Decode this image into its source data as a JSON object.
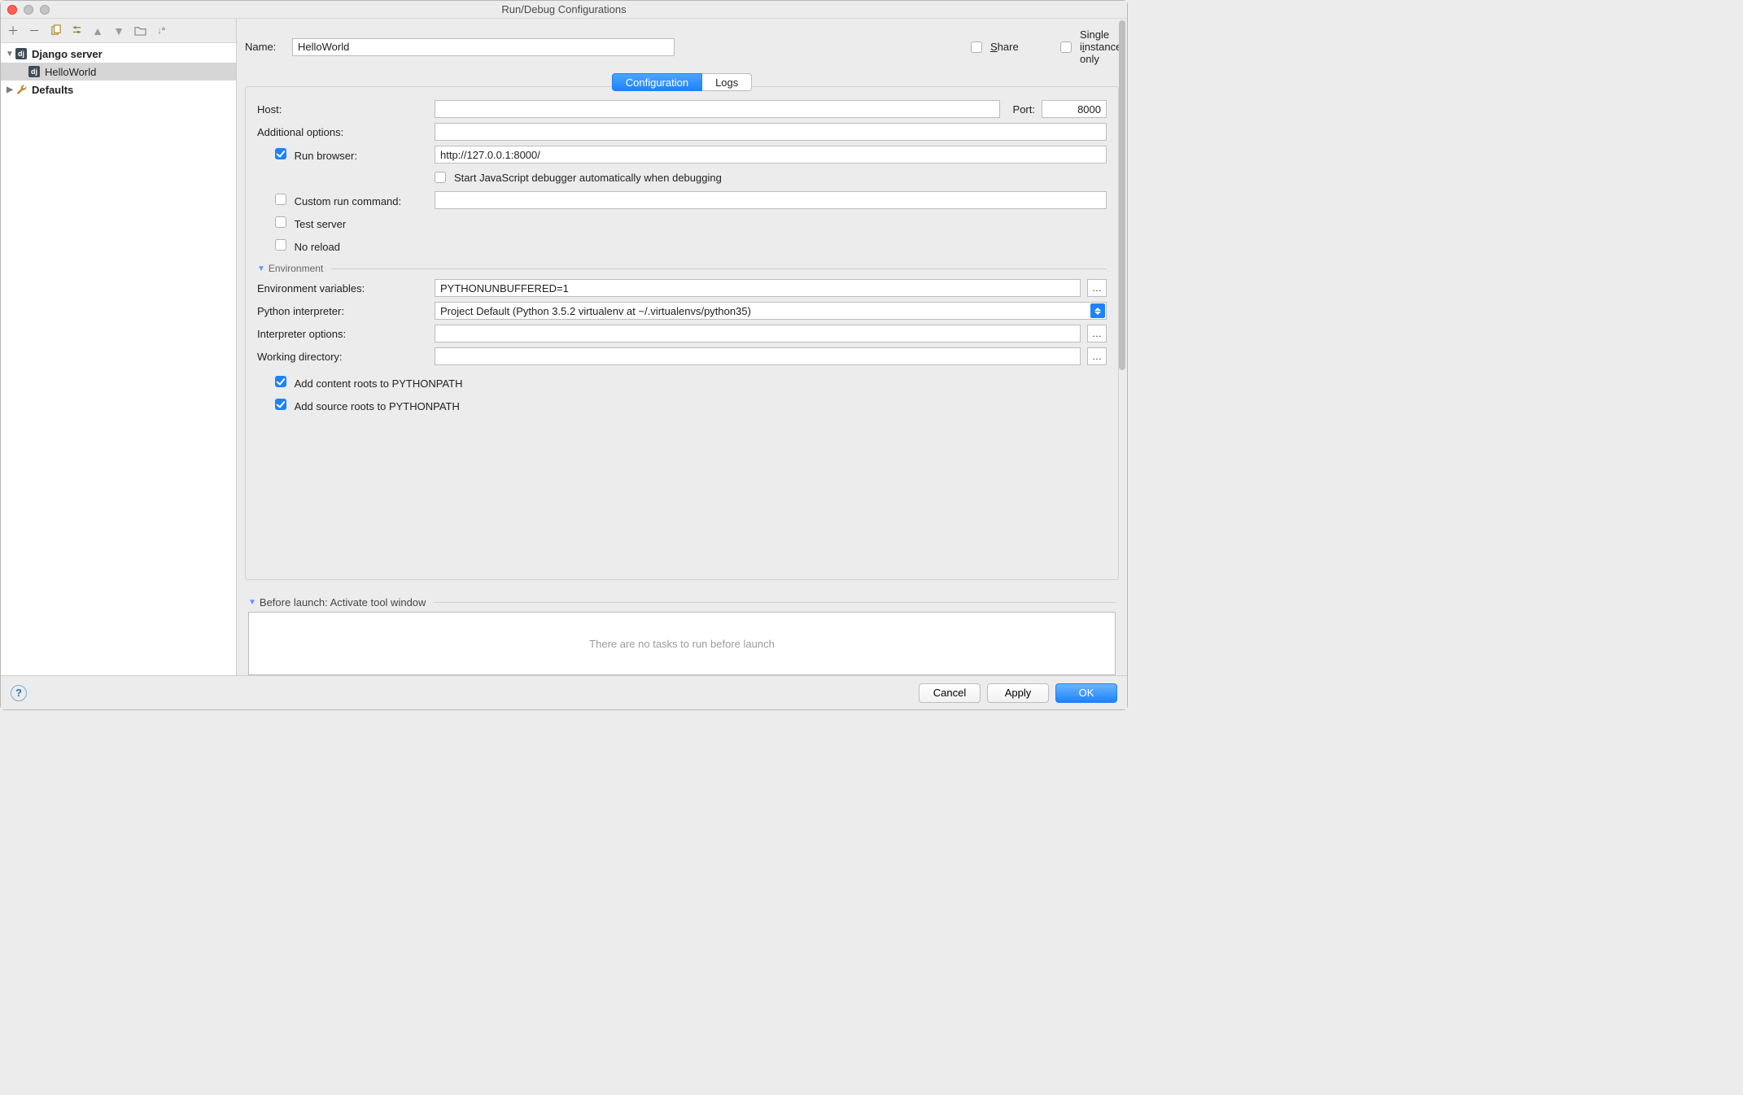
{
  "window": {
    "title": "Run/Debug Configurations"
  },
  "sidebar": {
    "items": [
      {
        "label": "Django server",
        "kind": "django-group"
      },
      {
        "label": "HelloWorld",
        "kind": "django-item"
      },
      {
        "label": "Defaults",
        "kind": "defaults-group"
      }
    ]
  },
  "nameRow": {
    "label": "Name:",
    "value": "HelloWorld",
    "share_label": "hare",
    "share_prefix": "S",
    "share_checked": false,
    "single_label": "nstance only",
    "single_prefix": "Single i",
    "single_checked": false
  },
  "tabs": {
    "configuration": "Configuration",
    "logs": "Logs"
  },
  "config": {
    "host_label": "Host:",
    "host_value": "",
    "port_label": "Port:",
    "port_value": "8000",
    "additional_label": "Additional options:",
    "additional_value": "",
    "run_browser_label": "Run browser:",
    "run_browser_checked": true,
    "run_browser_value": "http://127.0.0.1:8000/",
    "js_debugger_label": "Start JavaScript debugger automatically when debugging",
    "js_debugger_checked": false,
    "custom_run_label": "Custom run command:",
    "custom_run_checked": false,
    "custom_run_value": "",
    "test_server_label": "Test server",
    "test_server_checked": false,
    "no_reload_label": "No reload",
    "no_reload_checked": false,
    "env_section": "Environment",
    "env_vars_label": "Environment variables:",
    "env_vars_value": "PYTHONUNBUFFERED=1",
    "interpreter_label": "Python interpreter:",
    "interpreter_value": "Project Default (Python 3.5.2 virtualenv at ~/.virtualenvs/python35)",
    "interp_opts_label": "Interpreter options:",
    "interp_opts_value": "",
    "workdir_label": "Working directory:",
    "workdir_value": "",
    "add_content_label": "Add content roots to PYTHONPATH",
    "add_content_checked": true,
    "add_source_label": "Add source roots to PYTHONPATH",
    "add_source_checked": true
  },
  "beforeLaunch": {
    "header": "Before launch: Activate tool window",
    "empty": "There are no tasks to run before launch"
  },
  "buttons": {
    "cancel": "Cancel",
    "apply": "Apply",
    "ok": "OK"
  }
}
